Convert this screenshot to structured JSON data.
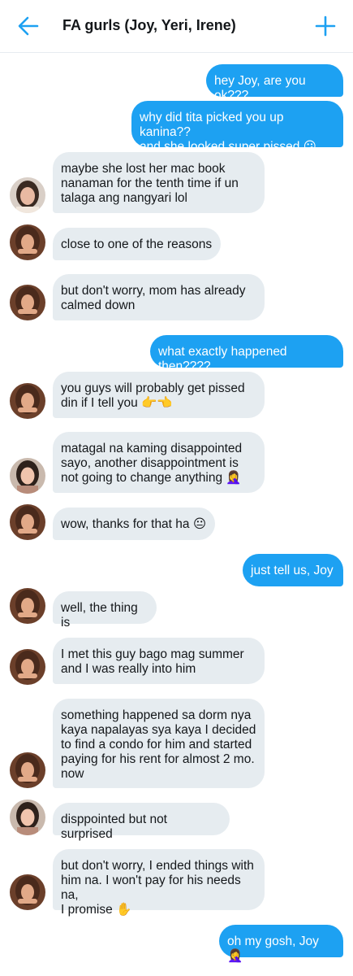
{
  "header": {
    "title": "FA gurls (Joy, Yeri, Irene)",
    "back_icon": "arrow-left-icon",
    "add_icon": "plus-icon",
    "accent_color": "#1da1f2"
  },
  "messages": [
    {
      "dir": "out",
      "text": "hey Joy, are you ok???"
    },
    {
      "dir": "out",
      "text": "why did tita picked you up kanina??\nand she looked super pissed 😕"
    },
    {
      "dir": "in",
      "text": "maybe she lost her mac book\nnanaman for the tenth time if un\ntalaga ang nangyari lol",
      "avatar": "yeri"
    },
    {
      "dir": "in",
      "text": "close to one of the reasons",
      "avatar": "joy"
    },
    {
      "dir": "in",
      "text": "but don't worry, mom has already\ncalmed down",
      "avatar": "joy"
    },
    {
      "dir": "out",
      "text": "what exactly happened then????"
    },
    {
      "dir": "in",
      "text": "you guys will probably get pissed\ndin if I tell you 👉👈",
      "avatar": "joy"
    },
    {
      "dir": "in",
      "text": "matagal na kaming disappointed\nsayo, another disappointment is\nnot going to change anything 🤦‍♀️",
      "avatar": "irene"
    },
    {
      "dir": "in",
      "text": "wow, thanks for that ha 😐",
      "avatar": "joy"
    },
    {
      "dir": "out",
      "text": "just tell us, Joy"
    },
    {
      "dir": "in",
      "text": "well, the thing is",
      "avatar": "joy"
    },
    {
      "dir": "in",
      "text": "I met this guy bago mag summer\nand I was really into him",
      "avatar": "joy"
    },
    {
      "dir": "in",
      "text": "something happened sa dorm nya\nkaya napalayas sya kaya I decided\nto find a condo for him and started\npaying for his rent for almost 2 mo.\nnow",
      "avatar": "joy"
    },
    {
      "dir": "in",
      "text": "disppointed but not surprised",
      "avatar": "irene"
    },
    {
      "dir": "in",
      "text": "but don't worry, I ended things with\nhim na. I won't pay for his needs na,\nI promise ✋",
      "avatar": "joy"
    },
    {
      "dir": "out",
      "text": "oh my gosh, Joy 🤦‍♀️"
    }
  ]
}
